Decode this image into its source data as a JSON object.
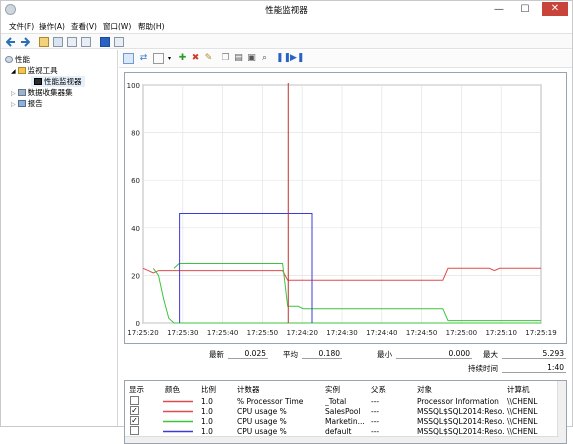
{
  "window": {
    "title": "性能监视器",
    "minimize_glyph": "—",
    "maximize_glyph": "☐",
    "close_glyph": "✕"
  },
  "menu": [
    "文件(F)",
    "操作(A)",
    "查看(V)",
    "窗口(W)",
    "帮助(H)"
  ],
  "tree": {
    "root": "性能",
    "monitoring_tools": "监视工具",
    "perfmon": "性能监视器",
    "data_collector_sets": "数据收集器集",
    "reports": "报告"
  },
  "chart_data": {
    "type": "line",
    "ylim": [
      0,
      100
    ],
    "yticks": [
      "0",
      "20",
      "40",
      "60",
      "80",
      "100"
    ],
    "xticks": [
      "17:25:20",
      "17:25:30",
      "17:25:40",
      "17:25:50",
      "17:24:20",
      "17:24:30",
      "17:24:40",
      "17:24:50",
      "17:25:00",
      "17:25:10",
      "17:25:19"
    ],
    "series": [
      {
        "name": "% Processor Time",
        "color": "#e04b4b",
        "values": [
          23,
          22,
          21,
          22,
          22,
          22,
          22,
          22,
          22,
          22,
          22,
          22,
          22,
          22,
          22,
          22,
          22,
          22,
          22,
          22,
          22,
          22,
          22,
          22,
          22,
          22,
          22,
          22,
          18,
          18,
          18,
          18,
          18,
          18,
          18,
          18,
          18,
          18,
          18,
          18,
          18,
          18,
          18,
          18,
          18,
          18,
          18,
          18,
          18,
          18,
          18,
          18,
          18,
          18,
          18,
          18,
          18,
          18,
          18,
          23,
          23,
          23,
          23,
          23,
          23,
          23,
          23,
          23,
          22,
          23,
          23,
          23,
          23,
          23,
          23,
          23,
          23,
          23
        ]
      },
      {
        "name": "CPU usage %",
        "color": "#3cc43c",
        "values": [
          null,
          null,
          null,
          null,
          null,
          null,
          23,
          25,
          25,
          25,
          25,
          25,
          25,
          25,
          25,
          25,
          25,
          25,
          25,
          25,
          25,
          25,
          25,
          25,
          25,
          25,
          25,
          25,
          7,
          7,
          7,
          6,
          6,
          6,
          6,
          6,
          6,
          6,
          6,
          6,
          6,
          6,
          6,
          6,
          6,
          6,
          6,
          6,
          6,
          6,
          6,
          6,
          6,
          6,
          6,
          6,
          6,
          6,
          6,
          1,
          1,
          1,
          1,
          1,
          1,
          1,
          1,
          1,
          1,
          1,
          1,
          1,
          1,
          1,
          1,
          1,
          1,
          1
        ]
      },
      {
        "name": "CPU usage %",
        "color": "#3cc43c",
        "values": [
          null,
          null,
          23,
          20,
          10,
          2,
          0,
          0,
          0,
          0,
          0,
          0,
          0,
          0,
          0,
          0,
          0,
          0,
          0,
          0,
          0,
          0,
          0,
          0,
          0,
          0,
          0,
          0,
          0,
          0,
          0,
          0,
          0,
          0,
          0,
          0,
          0,
          0,
          0,
          0,
          0,
          0,
          0,
          0,
          0,
          0,
          0,
          0,
          0,
          0,
          0,
          0,
          0,
          0,
          0,
          0,
          0,
          0,
          0,
          0,
          0,
          0,
          0,
          0,
          0,
          0,
          0,
          0,
          0,
          0,
          0,
          0,
          0,
          0,
          0,
          0,
          0,
          0
        ]
      },
      {
        "name": "CPU usage %",
        "color": "#3b3bd6",
        "values": [
          null,
          null,
          null,
          null,
          46,
          46,
          46,
          46,
          46,
          46,
          46,
          46,
          46,
          46,
          46,
          46,
          46,
          46,
          46,
          46,
          46,
          46,
          46,
          46,
          46,
          46,
          46,
          46,
          46,
          46,
          46,
          46
        ]
      },
      {
        "name": "cursor",
        "color": "#c03030"
      }
    ]
  },
  "stats": {
    "last_label": "最新",
    "last_value": "0.025",
    "avg_label": "平均",
    "avg_value": "0.180",
    "min_label": "最小",
    "min_value": "0.000",
    "max_label": "最大",
    "max_value": "5.293",
    "duration_label": "持续时间",
    "duration_value": "1:40"
  },
  "legend": {
    "headers": [
      "显示",
      "颜色",
      "比例",
      "计数器",
      "实例",
      "父系",
      "对象",
      "计算机"
    ],
    "rows": [
      {
        "checked": "",
        "color": "#e04b4b",
        "scale": "1.0",
        "counter": "% Processor Time",
        "instance": "_Total",
        "parent": "---",
        "object": "Processor Information",
        "computer": "\\\\CHENL"
      },
      {
        "checked": "✓",
        "color": "#e04b4b",
        "scale": "1.0",
        "counter": "CPU usage %",
        "instance": "SalesPool",
        "parent": "---",
        "object": "MSSQL$SQL2014:Reso...",
        "computer": "\\\\CHENL"
      },
      {
        "checked": "✓",
        "color": "#3cc43c",
        "scale": "1.0",
        "counter": "CPU usage %",
        "instance": "Marketin...",
        "parent": "---",
        "object": "MSSQL$SQL2014:Reso...",
        "computer": "\\\\CHENL"
      },
      {
        "checked": "",
        "color": "#3b3bd6",
        "scale": "1.0",
        "counter": "CPU usage %",
        "instance": "default",
        "parent": "---",
        "object": "MSSQL$SQL2014:Reso...",
        "computer": "\\\\CHENL"
      }
    ]
  }
}
